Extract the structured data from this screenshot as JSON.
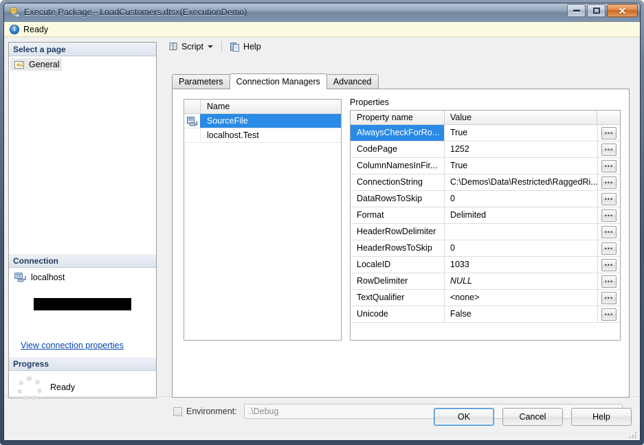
{
  "window": {
    "title": "Execute Package - LoadCustomers.dtsx(ExecutionDemo)",
    "icon": "package-icon",
    "minimize_label": "–",
    "maximize_label": "□",
    "close_label": "✕"
  },
  "status": {
    "icon": "info-icon",
    "text": "Ready"
  },
  "sidebar": {
    "select_a_page_header": "Select a page",
    "pages": [
      {
        "label": "General",
        "icon": "page-general-icon",
        "selected": true
      }
    ],
    "connection": {
      "header": "Connection",
      "server_icon": "server-icon",
      "server": "localhost",
      "redacted": "",
      "view_properties_link": "View connection properties"
    },
    "progress": {
      "header": "Progress",
      "spinner_icon": "progress-spinner-icon",
      "text": "Ready"
    }
  },
  "toolbar": {
    "script_icon": "script-icon",
    "script_label": "Script",
    "dropdown_icon": "chevron-down-icon",
    "help_icon": "help-icon",
    "help_label": "Help"
  },
  "tabs": [
    {
      "label": "Parameters",
      "active": false
    },
    {
      "label": "Connection Managers",
      "active": true
    },
    {
      "label": "Advanced",
      "active": false
    }
  ],
  "connection_managers": {
    "column_header": "Name",
    "rows": [
      {
        "name": "SourceFile",
        "icon": "connection-manager-icon",
        "selected": true
      },
      {
        "name": "localhost.Test",
        "icon": "",
        "selected": false
      }
    ]
  },
  "properties": {
    "label": "Properties",
    "columns": {
      "name": "Property name",
      "value": "Value"
    },
    "ellipsis_button_label": "•••",
    "rows": [
      {
        "name": "AlwaysCheckForRo...",
        "value": "True",
        "selected": true,
        "italic": false
      },
      {
        "name": "CodePage",
        "value": "1252",
        "selected": false,
        "italic": false
      },
      {
        "name": "ColumnNamesInFir...",
        "value": "True",
        "selected": false,
        "italic": false
      },
      {
        "name": "ConnectionString",
        "value": "C:\\Demos\\Data\\Restricted\\RaggedRi...",
        "selected": false,
        "italic": false
      },
      {
        "name": "DataRowsToSkip",
        "value": "0",
        "selected": false,
        "italic": false
      },
      {
        "name": "Format",
        "value": "Delimited",
        "selected": false,
        "italic": false
      },
      {
        "name": "HeaderRowDelimiter",
        "value": "",
        "selected": false,
        "italic": false
      },
      {
        "name": "HeaderRowsToSkip",
        "value": "0",
        "selected": false,
        "italic": false
      },
      {
        "name": "LocaleID",
        "value": "1033",
        "selected": false,
        "italic": false
      },
      {
        "name": "RowDelimiter",
        "value": "NULL",
        "selected": false,
        "italic": true
      },
      {
        "name": "TextQualifier",
        "value": "<none>",
        "selected": false,
        "italic": false
      },
      {
        "name": "Unicode",
        "value": "False",
        "selected": false,
        "italic": false
      }
    ]
  },
  "environment": {
    "checkbox_checked": false,
    "label": "Environment:",
    "value": ".\\Debug",
    "caret_icon": "chevron-down-icon"
  },
  "footer": {
    "buttons": [
      {
        "label": "OK",
        "default": true
      },
      {
        "label": "Cancel",
        "default": false
      },
      {
        "label": "Help",
        "default": false
      }
    ]
  },
  "colors": {
    "selection_blue": "#2a8ae5",
    "status_bar_yellow": "#fcfbe0",
    "link_blue": "#0645ad",
    "frame_blue": "#3a4a60"
  }
}
